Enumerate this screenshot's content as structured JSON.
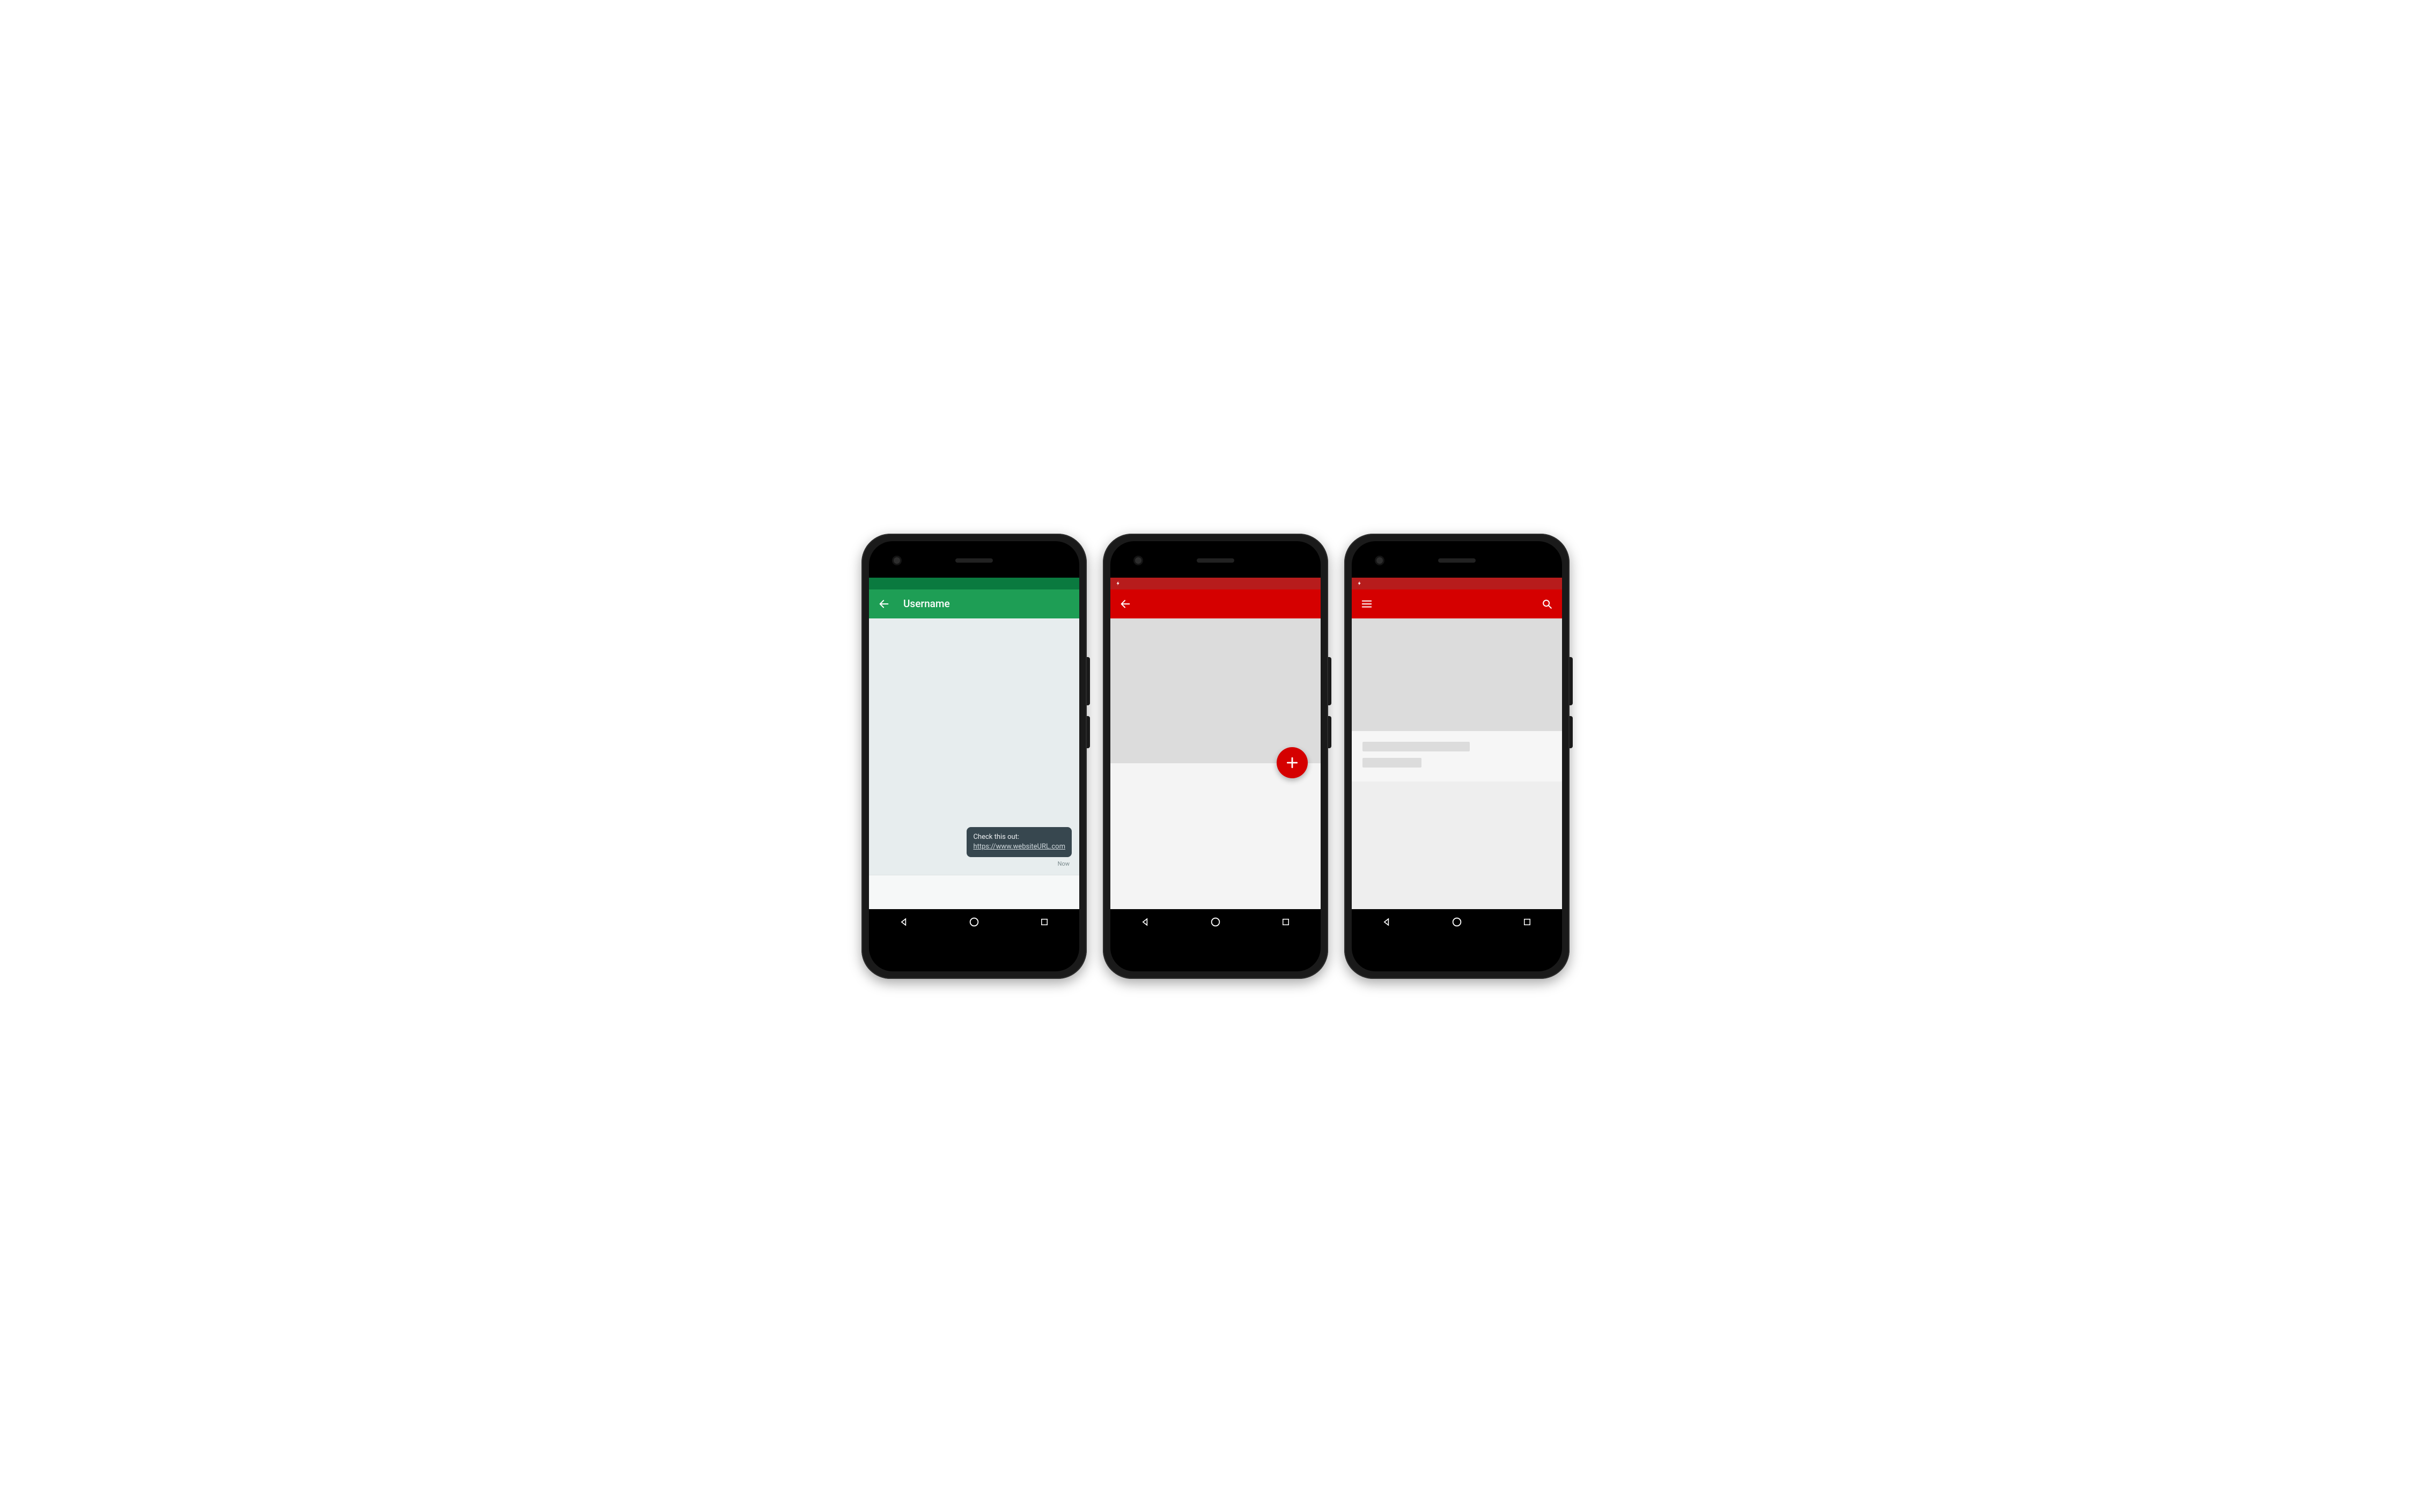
{
  "colors": {
    "green_primary": "#1e9e55",
    "green_dark": "#0a7a3f",
    "red_primary": "#d50000",
    "red_dark": "#b71c1c",
    "chat_bubble": "#37474f"
  },
  "phone1": {
    "appbar": {
      "title": "Username"
    },
    "message": {
      "prefix": "Check this out:",
      "link_text": "https://www.websiteURL.com"
    },
    "timestamp": "Now"
  },
  "phone2": {},
  "phone3": {}
}
